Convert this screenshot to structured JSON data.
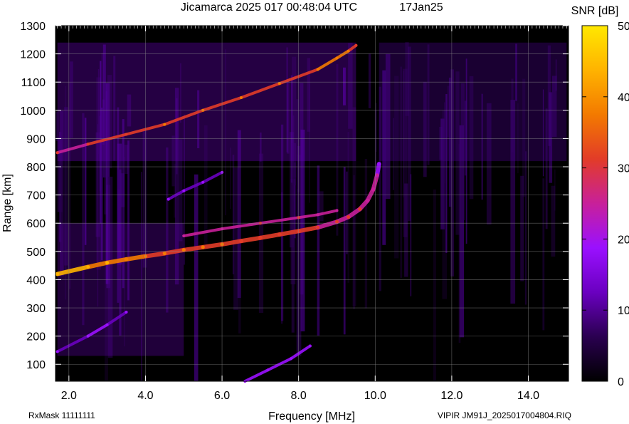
{
  "header": {
    "title": "Jicamarca 2025 017 00:48:04 UTC",
    "date": "17Jan25"
  },
  "footer": {
    "rxmask": "RxMask 11111111",
    "file": "VIPIR  JM91J_2025017004804.RIQ"
  },
  "chart_data": {
    "type": "heatmap",
    "title": "Jicamarca 2025 017 00:48:04 UTC",
    "xlabel": "Frequency [MHz]",
    "ylabel": "Range [km]",
    "xlim": [
      1.65,
      15.05
    ],
    "ylim": [
      40,
      1300
    ],
    "xticks": [
      2.0,
      4.0,
      6.0,
      8.0,
      10.0,
      12.0,
      14.0
    ],
    "xtick_labels": [
      "2.0",
      "4.0",
      "6.0",
      "8.0",
      "10.0",
      "12.0",
      "14.0"
    ],
    "yticks": [
      100,
      200,
      300,
      400,
      500,
      600,
      700,
      800,
      900,
      1000,
      1100,
      1200,
      1300
    ],
    "ytick_labels": [
      "100",
      "200",
      "300",
      "400",
      "500",
      "600",
      "700",
      "800",
      "900",
      "1000",
      "1100",
      "1200",
      "1300"
    ],
    "grid": true,
    "colorbar": {
      "label": "SNR [dB]",
      "range": [
        0,
        50
      ],
      "ticks": [
        0,
        10,
        20,
        30,
        40,
        50
      ],
      "tick_labels": [
        "0",
        "10",
        "20",
        "30",
        "40",
        "50"
      ],
      "colormap": [
        "#000000",
        "#2a0050",
        "#6a00c0",
        "#9a10ff",
        "#c8209a",
        "#e23c28",
        "#f37a00",
        "#ffb300",
        "#ffe800"
      ]
    },
    "traces": [
      {
        "kind": "F2 echo, 1-hop",
        "frequency": [
          1.7,
          2.5,
          3.0,
          3.5,
          4.0,
          4.5,
          5.0,
          5.5,
          6.0,
          6.5,
          7.0,
          7.5,
          8.0,
          8.5,
          9.0,
          9.3,
          9.6,
          9.8,
          9.95,
          10.05,
          10.1
        ],
        "range": [
          420,
          445,
          460,
          472,
          483,
          493,
          505,
          515,
          525,
          537,
          548,
          560,
          572,
          585,
          605,
          622,
          650,
          680,
          720,
          770,
          810
        ],
        "snr": [
          42,
          40,
          38,
          36,
          34,
          33,
          32,
          32,
          31,
          30,
          30,
          29,
          29,
          28,
          27,
          26,
          25,
          24,
          22,
          18,
          14
        ]
      },
      {
        "kind": "F2 echo, 2-hop",
        "frequency": [
          1.7,
          2.5,
          3.5,
          4.5,
          5.5,
          6.5,
          7.5,
          8.5,
          9.0,
          9.3,
          9.5
        ],
        "range": [
          850,
          880,
          915,
          950,
          1000,
          1045,
          1095,
          1145,
          1185,
          1210,
          1230
        ],
        "snr": [
          28,
          30,
          30,
          31,
          33,
          33,
          33,
          36,
          36,
          34,
          30
        ]
      },
      {
        "kind": "weak secondary trace",
        "frequency": [
          5.0,
          6.0,
          7.0,
          8.0,
          8.5,
          9.0
        ],
        "range": [
          555,
          580,
          600,
          620,
          630,
          645
        ],
        "snr": [
          22,
          24,
          25,
          26,
          24,
          20
        ]
      },
      {
        "kind": "oblique trace",
        "frequency": [
          4.6,
          5.0,
          5.5,
          6.0
        ],
        "range": [
          685,
          715,
          745,
          780
        ],
        "snr": [
          14,
          15,
          15,
          14
        ]
      },
      {
        "kind": "low-range trace",
        "frequency": [
          1.7,
          2.5,
          3.0,
          3.5
        ],
        "range": [
          145,
          200,
          240,
          285
        ],
        "snr": [
          14,
          16,
          15,
          13
        ]
      },
      {
        "kind": "diagonal trace",
        "frequency": [
          6.6,
          7.2,
          7.8,
          8.3
        ],
        "range": [
          40,
          80,
          120,
          165
        ],
        "snr": [
          16,
          17,
          16,
          15
        ]
      }
    ]
  }
}
